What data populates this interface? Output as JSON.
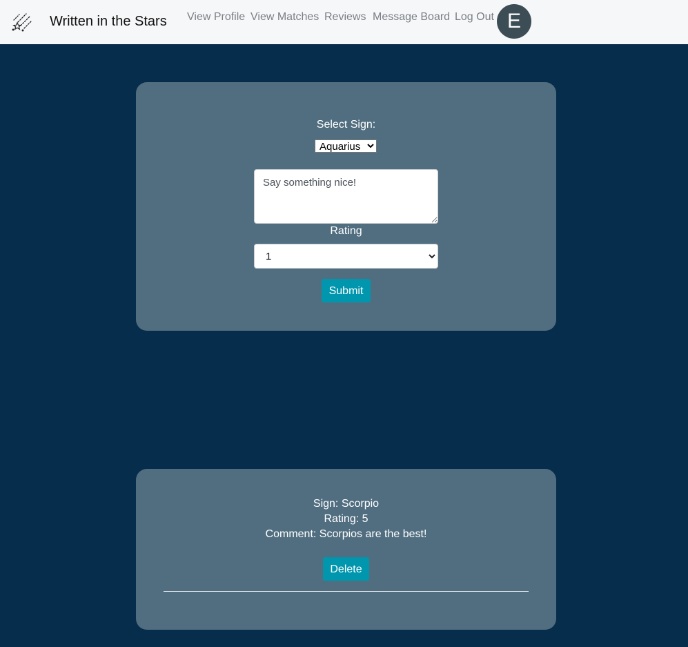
{
  "navbar": {
    "brand_icon": "shooting-stars-icon",
    "brand_title": "Written in the Stars",
    "links": [
      "View Profile",
      "View Matches",
      "Reviews",
      "Message Board",
      "Log Out"
    ],
    "avatar_letter": "E"
  },
  "review_form": {
    "select_sign_label": "Select Sign:",
    "sign_selected": "Aquarius",
    "comment_placeholder": "Say something nice!",
    "rating_label": "Rating",
    "rating_selected": "1",
    "submit_label": "Submit"
  },
  "reviews": [
    {
      "sign": "Sign: Scorpio",
      "rating": "Rating: 5",
      "comment": "Comment: Scorpios are the best!",
      "delete_label": "Delete"
    }
  ],
  "colors": {
    "page_background": "#072d4d",
    "card_background": "#516e80",
    "navbar_background": "#f6f7f9",
    "button": "#0096ae",
    "avatar": "#3d4d56"
  }
}
